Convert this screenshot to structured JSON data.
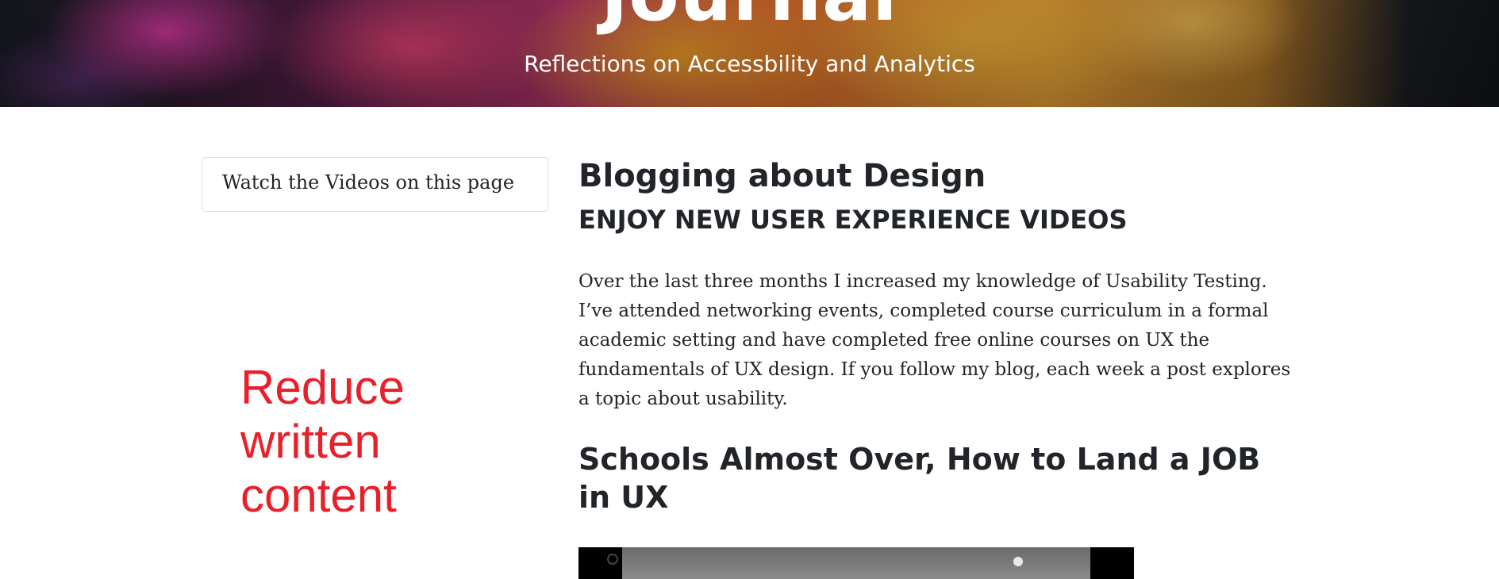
{
  "header": {
    "title": "Journal",
    "subtitle": "Reflections on Accessbility and Analytics"
  },
  "sidebar": {
    "box_label": "Watch the Videos on this page"
  },
  "annotation": {
    "text": "Reduce written content",
    "color": "#e8202a"
  },
  "main": {
    "post_title": "Blogging about Design",
    "post_subtitle": "ENJOY NEW USER EXPERIENCE VIDEOS",
    "post_body": "Over the last three months I increased my knowledge of Usability Testing. I’ve attended networking events, completed course curriculum in a formal academic setting and have completed free online courses on UX the fundamentals of UX design. If you follow my blog, each week a post explores a topic about usability.",
    "section_title": "Schools Almost Over, How to Land a JOB in UX"
  },
  "colors": {
    "text": "#212529",
    "background": "#ffffff"
  }
}
